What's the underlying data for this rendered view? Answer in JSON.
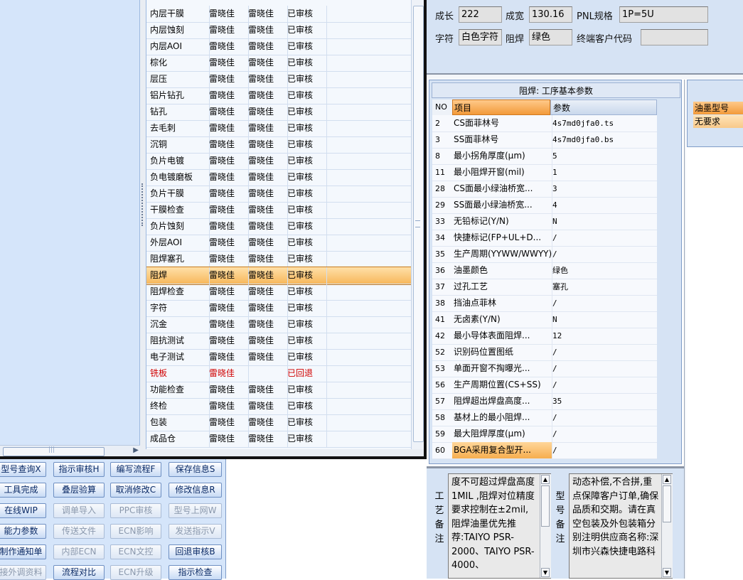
{
  "grid": {
    "rows": [
      {
        "name": "内层干膜",
        "a": "雷晓佳",
        "b": "雷晓佳",
        "status": "已审核"
      },
      {
        "name": "内层蚀刻",
        "a": "雷晓佳",
        "b": "雷晓佳",
        "status": "已审核"
      },
      {
        "name": "内层AOI",
        "a": "雷晓佳",
        "b": "雷晓佳",
        "status": "已审核"
      },
      {
        "name": "棕化",
        "a": "雷晓佳",
        "b": "雷晓佳",
        "status": "已审核"
      },
      {
        "name": "层压",
        "a": "雷晓佳",
        "b": "雷晓佳",
        "status": "已审核"
      },
      {
        "name": "铝片钻孔",
        "a": "雷晓佳",
        "b": "雷晓佳",
        "status": "已审核"
      },
      {
        "name": "钻孔",
        "a": "雷晓佳",
        "b": "雷晓佳",
        "status": "已审核"
      },
      {
        "name": "去毛刺",
        "a": "雷晓佳",
        "b": "雷晓佳",
        "status": "已审核"
      },
      {
        "name": "沉铜",
        "a": "雷晓佳",
        "b": "雷晓佳",
        "status": "已审核"
      },
      {
        "name": "负片电镀",
        "a": "雷晓佳",
        "b": "雷晓佳",
        "status": "已审核"
      },
      {
        "name": "负电镀磨板",
        "a": "雷晓佳",
        "b": "雷晓佳",
        "status": "已审核"
      },
      {
        "name": "负片干膜",
        "a": "雷晓佳",
        "b": "雷晓佳",
        "status": "已审核"
      },
      {
        "name": "干膜检查",
        "a": "雷晓佳",
        "b": "雷晓佳",
        "status": "已审核"
      },
      {
        "name": "负片蚀刻",
        "a": "雷晓佳",
        "b": "雷晓佳",
        "status": "已审核"
      },
      {
        "name": "外层AOI",
        "a": "雷晓佳",
        "b": "雷晓佳",
        "status": "已审核"
      },
      {
        "name": "阻焊塞孔",
        "a": "雷晓佳",
        "b": "雷晓佳",
        "status": "已审核"
      },
      {
        "name": "阻焊",
        "a": "雷晓佳",
        "b": "雷晓佳",
        "status": "已审核"
      },
      {
        "name": "阻焊检查",
        "a": "雷晓佳",
        "b": "雷晓佳",
        "status": "已审核"
      },
      {
        "name": "字符",
        "a": "雷晓佳",
        "b": "雷晓佳",
        "status": "已审核"
      },
      {
        "name": "沉金",
        "a": "雷晓佳",
        "b": "雷晓佳",
        "status": "已审核"
      },
      {
        "name": "阻抗测试",
        "a": "雷晓佳",
        "b": "雷晓佳",
        "status": "已审核"
      },
      {
        "name": "电子测试",
        "a": "雷晓佳",
        "b": "雷晓佳",
        "status": "已审核"
      },
      {
        "name": "铣板",
        "a": "雷晓佳",
        "b": "",
        "status": "已回退"
      },
      {
        "name": "功能检查",
        "a": "雷晓佳",
        "b": "雷晓佳",
        "status": "已审核"
      },
      {
        "name": "终检",
        "a": "雷晓佳",
        "b": "雷晓佳",
        "status": "已审核"
      },
      {
        "name": "包装",
        "a": "雷晓佳",
        "b": "雷晓佳",
        "status": "已审核"
      },
      {
        "name": "成品仓",
        "a": "雷晓佳",
        "b": "雷晓佳",
        "status": "已审核"
      }
    ],
    "selected_row": "阻焊",
    "returned_row": "铣板"
  },
  "buttons": [
    {
      "label": "型号查询X",
      "enabled": true
    },
    {
      "label": "指示审核H",
      "enabled": true
    },
    {
      "label": "编写流程F",
      "enabled": true
    },
    {
      "label": "保存信息S",
      "enabled": true
    },
    {
      "label": "工具完成",
      "enabled": true
    },
    {
      "label": "叠层验算",
      "enabled": true
    },
    {
      "label": "取消修改C",
      "enabled": true
    },
    {
      "label": "修改信息R",
      "enabled": true
    },
    {
      "label": "在线WIP",
      "enabled": true
    },
    {
      "label": "调单导入",
      "enabled": false
    },
    {
      "label": "PPC审核",
      "enabled": false
    },
    {
      "label": "型号上网W",
      "enabled": false
    },
    {
      "label": "能力参数",
      "enabled": true
    },
    {
      "label": "传送文件",
      "enabled": false
    },
    {
      "label": "ECN影响",
      "enabled": false
    },
    {
      "label": "发送指示V",
      "enabled": false
    },
    {
      "label": "制作通知单",
      "enabled": true
    },
    {
      "label": "内部ECN",
      "enabled": false
    },
    {
      "label": "ECN文控",
      "enabled": false
    },
    {
      "label": "回退审核B",
      "enabled": true
    },
    {
      "label": "接外调资料",
      "enabled": false
    },
    {
      "label": "流程对比",
      "enabled": true
    },
    {
      "label": "ECN升级",
      "enabled": false
    },
    {
      "label": "指示检查",
      "enabled": true
    }
  ],
  "header": {
    "length_label": "成长",
    "length_value": "222",
    "width_label": "成宽",
    "width_value": "130.16",
    "pnl_label": "PNL规格",
    "pnl_value": "1P=5U",
    "char_label": "字符",
    "char_value": "白色字符",
    "mask_label": "阻焊",
    "mask_value": "绿色",
    "customer_code_label": "终端客户代码",
    "customer_code_value": ""
  },
  "params": {
    "title": "阻焊: 工序基本参数",
    "col_no": "NO",
    "col_item": "项目",
    "col_value": "参数",
    "rows": [
      {
        "no": "2",
        "item": "CS面菲林号",
        "value": "4s7md0jfa0.ts"
      },
      {
        "no": "3",
        "item": "SS面菲林号",
        "value": "4s7md0jfa0.bs"
      },
      {
        "no": "8",
        "item": "最小拐角厚度(μm)",
        "value": "5"
      },
      {
        "no": "11",
        "item": "最小阻焊开窗(mil)",
        "value": "1"
      },
      {
        "no": "28",
        "item": "CS面最小绿油桥宽...",
        "value": "3"
      },
      {
        "no": "29",
        "item": "SS面最小绿油桥宽...",
        "value": "4"
      },
      {
        "no": "33",
        "item": "无铅标记(Y/N)",
        "value": "N"
      },
      {
        "no": "34",
        "item": "快捷标记(FP+UL+D...",
        "value": "/"
      },
      {
        "no": "35",
        "item": "生产周期(YYWW/WWYY)",
        "value": "/"
      },
      {
        "no": "36",
        "item": "油墨颜色",
        "value": "绿色"
      },
      {
        "no": "37",
        "item": "过孔工艺",
        "value": "塞孔"
      },
      {
        "no": "38",
        "item": "挡油点菲林",
        "value": "/"
      },
      {
        "no": "41",
        "item": "无卤素(Y/N)",
        "value": "N"
      },
      {
        "no": "42",
        "item": "最小导体表面阻焊...",
        "value": "12"
      },
      {
        "no": "52",
        "item": "识别码位置图纸",
        "value": "/"
      },
      {
        "no": "53",
        "item": "单面开窗不掏曝光...",
        "value": "/"
      },
      {
        "no": "56",
        "item": "生产周期位置(CS+SS)",
        "value": "/"
      },
      {
        "no": "57",
        "item": "阻焊超出焊盘高度...",
        "value": "35"
      },
      {
        "no": "58",
        "item": "基材上的最小阻焊...",
        "value": "/"
      },
      {
        "no": "59",
        "item": "最大阻焊厚度(μm)",
        "value": "/"
      },
      {
        "no": "60",
        "item": "BGA采用复合型开...",
        "value": "/"
      }
    ],
    "highlight_no": "60"
  },
  "ink": {
    "header": "油墨型号",
    "value": "无要求"
  },
  "notes": {
    "process_label": "工艺备注",
    "process_text": "度不可超过焊盘高度1MIL ,阻焊对位精度要求控制在±2mil,阻焊油墨优先推荐:TAIYO PSR-2000、TAIYO PSR-4000、",
    "model_label": "型号备注",
    "model_text": "动态补偿,不合拼,重点保障客户订单,确保品质和交期。请在真空包装及外包装箱分别注明供应商名称:深圳市兴森快捷电路科"
  },
  "colors": {
    "panel_blue": "#d5e5fa",
    "selection_orange": "#f7b85c",
    "returned_red": "#d00000"
  }
}
